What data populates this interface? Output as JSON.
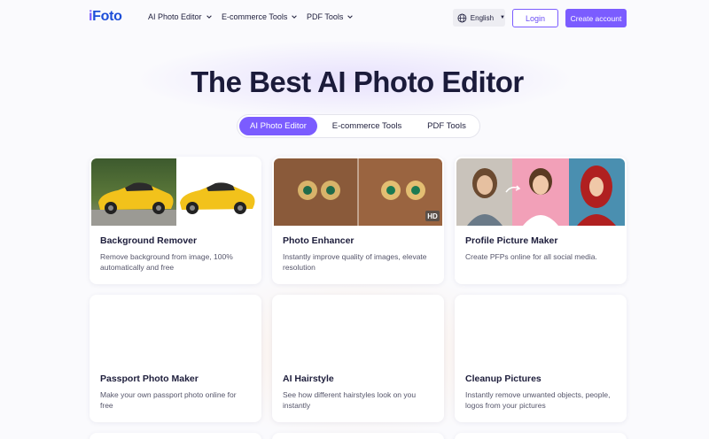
{
  "header": {
    "logo_i": "i",
    "logo_rest": "Foto",
    "nav": [
      {
        "label": "AI Photo Editor"
      },
      {
        "label": "E-commerce Tools"
      },
      {
        "label": "PDF Tools"
      }
    ],
    "language": "English",
    "login_label": "Login",
    "create_account_label": "Create account"
  },
  "hero": {
    "title": "The Best AI Photo Editor",
    "tabs": [
      {
        "label": "AI Photo Editor",
        "active": true
      },
      {
        "label": "E-commerce Tools",
        "active": false
      },
      {
        "label": "PDF Tools",
        "active": false
      }
    ]
  },
  "cards": [
    {
      "title": "Background Remover",
      "desc": "Remove background from image, 100% automatically and free"
    },
    {
      "title": "Photo Enhancer",
      "desc": "Instantly improve quality of images, elevate resolution",
      "badge": "HD"
    },
    {
      "title": "Profile Picture Maker",
      "desc": "Create PFPs online for all social media."
    },
    {
      "title": "Passport Photo Maker",
      "desc": "Make your own passport photo online for free"
    },
    {
      "title": "AI Hairstyle",
      "desc": "See how different hairstyles look on you instantly"
    },
    {
      "title": "Cleanup Pictures",
      "desc": "Instantly remove unwanted objects, people, logos from your pictures"
    }
  ],
  "colors": {
    "accent": "#7b5cff",
    "text": "#1d1d3b"
  }
}
